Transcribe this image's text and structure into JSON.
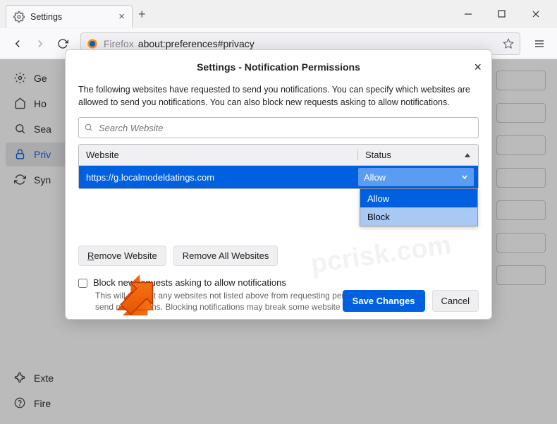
{
  "tab": {
    "title": "Settings"
  },
  "urlbar": {
    "prefix": "Firefox",
    "url": "about:preferences#privacy"
  },
  "sidebar": {
    "items": [
      {
        "label": "Ge"
      },
      {
        "label": "Ho"
      },
      {
        "label": "Sea"
      },
      {
        "label": "Priv"
      },
      {
        "label": "Syn"
      }
    ],
    "bottom": [
      {
        "label": "Exte"
      },
      {
        "label": "Fire"
      }
    ]
  },
  "dialog": {
    "title": "Settings - Notification Permissions",
    "description": "The following websites have requested to send you notifications. You can specify which websites are allowed to send you notifications. You can also block new requests asking to allow notifications.",
    "search_placeholder": "Search Website",
    "columns": {
      "website": "Website",
      "status": "Status"
    },
    "rows": [
      {
        "url": "https://g.localmodeldatings.com",
        "status": "Allow"
      }
    ],
    "options": [
      "Allow",
      "Block"
    ],
    "remove_website": "Remove Website",
    "remove_all": "Remove All Websites",
    "block_new_label": "Block new requests asking to allow notifications",
    "block_new_desc": "This will prevent any websites not listed above from requesting permission to send notifications. Blocking notifications may break some website features.",
    "save": "Save Changes",
    "cancel": "Cancel"
  },
  "watermark": "pcrisk.com"
}
